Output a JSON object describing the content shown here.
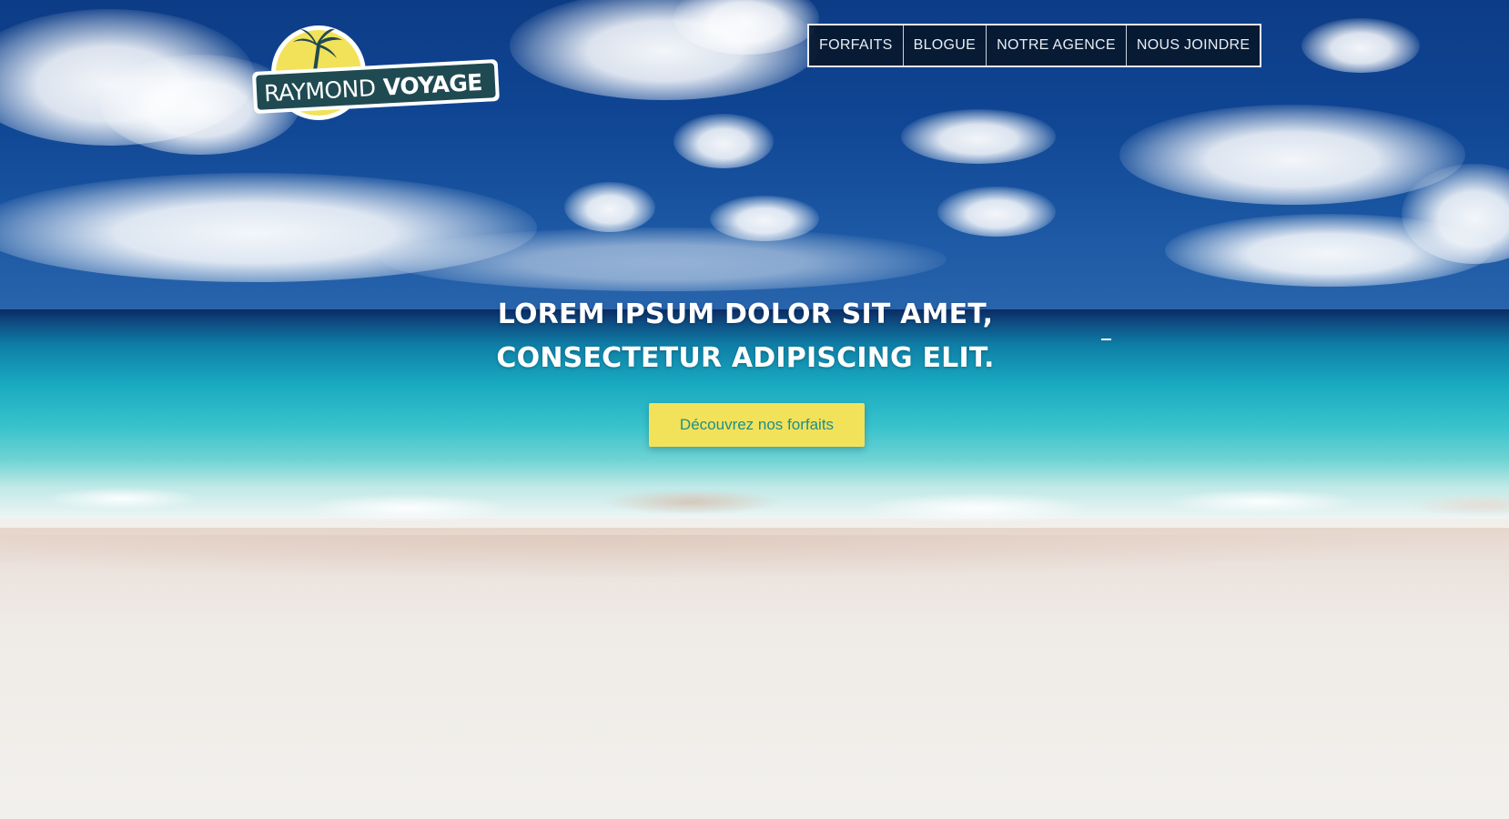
{
  "brand": {
    "name_part1": "RAYMOND",
    "name_part2": "VOYAGE",
    "logo_icon": "palm-island-sun-icon",
    "colors": {
      "badge_dark": "#1f4a52",
      "sun_yellow": "#f2e25a",
      "text_light": "#ffffff"
    }
  },
  "nav": {
    "items": [
      {
        "label": "FORFAITS"
      },
      {
        "label": "BLOGUE"
      },
      {
        "label": "NOTRE AGENCE"
      },
      {
        "label": "NOUS JOINDRE"
      }
    ],
    "colors": {
      "background": "#071628",
      "border": "#e9eef3",
      "text": "#e8eef4"
    }
  },
  "hero": {
    "title_line1": "LOREM IPSUM DOLOR SIT AMET,",
    "title_line2": "CONSECTETUR ADIPISCING ELIT.",
    "cta_label": "Découvrez nos forfaits",
    "background": "tropical-beach-photo",
    "colors": {
      "title": "#ffffff",
      "cta_background": "#f2e25a",
      "cta_text": "#1c8f8f"
    }
  }
}
